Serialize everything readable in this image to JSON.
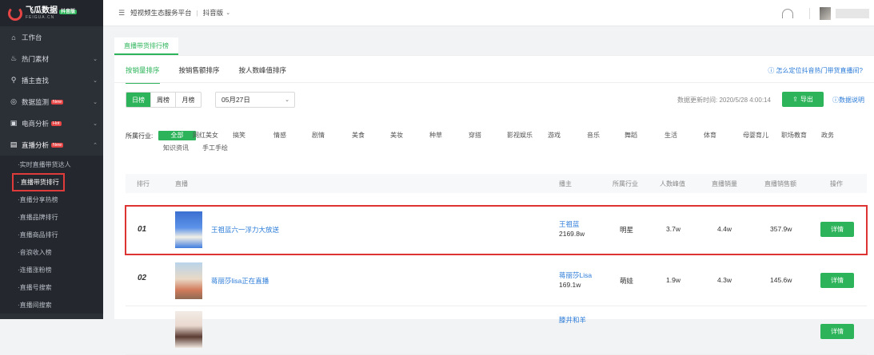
{
  "brand": {
    "name": "飞瓜数据",
    "badge": "抖音版",
    "sub": "FEIGUA.CN"
  },
  "sidebar": {
    "items": [
      {
        "label": "工作台",
        "icon": "home-icon"
      },
      {
        "label": "热门素材",
        "icon": "fire-icon"
      },
      {
        "label": "播主查找",
        "icon": "search-icon"
      },
      {
        "label": "数据监测",
        "icon": "monitor-icon",
        "badge": "New"
      },
      {
        "label": "电商分析",
        "icon": "shop-icon",
        "badge": "Hot"
      },
      {
        "label": "直播分析",
        "icon": "live-icon",
        "badge": "New"
      }
    ],
    "sub_items": [
      "实时直播带货达人",
      "直播带货排行",
      "直播分享热榜",
      "直播品牌排行",
      "直播商品排行",
      "音浪收入榜",
      "连播涨粉榜",
      "直播号搜索",
      "直播间搜索"
    ]
  },
  "topbar": {
    "platform": "短视频生态服务平台",
    "separator": "|",
    "version": "抖音版"
  },
  "card_tab": "直播带货排行榜",
  "sort_tabs": [
    "按销量排序",
    "按销售额排序",
    "按人数峰值排序"
  ],
  "help_link": "怎么定位抖音热门带货直播间?",
  "period_tabs": [
    "日榜",
    "周榜",
    "月榜"
  ],
  "date_value": "05月27日",
  "update_time": "数据更新时间: 2020/5/28 4:00:14",
  "export_label": "导出",
  "data_note_label": "数据说明",
  "industry": {
    "label": "所属行业:",
    "options": [
      "全部",
      "网红美女",
      "搞笑",
      "情感",
      "剧情",
      "美食",
      "美妆",
      "种草",
      "穿搭",
      "影视娱乐",
      "游戏",
      "音乐",
      "舞蹈",
      "生活",
      "体育",
      "母婴育儿",
      "职场教育",
      "政务",
      "知识资讯",
      "手工手绘"
    ]
  },
  "table": {
    "headers": [
      "排行",
      "直播",
      "播主",
      "所属行业",
      "人数峰值",
      "直播销量",
      "直播销售额",
      "操作"
    ],
    "rows": [
      {
        "rank": "01",
        "title": "王祖蓝六一浮力大放送",
        "host": "王祖蓝",
        "fans": "2169.8w",
        "industry": "明星",
        "peak": "3.7w",
        "sales": "4.4w",
        "amount": "357.9w",
        "action": "详情"
      },
      {
        "rank": "02",
        "title": "蒋丽莎lisa正在直播",
        "host": "蒋丽莎Lisa",
        "fans": "169.1w",
        "industry": "萌娃",
        "peak": "1.9w",
        "sales": "4.3w",
        "amount": "145.6w",
        "action": "详情"
      },
      {
        "rank": "03",
        "title": "",
        "host": "滕井和羊",
        "fans": "",
        "industry": "",
        "peak": "",
        "sales": "",
        "amount": "",
        "action": "详情"
      }
    ]
  },
  "colors": {
    "accent": "#2db45a",
    "sidebar_bg": "#2b2f36",
    "link": "#2b7bd8",
    "highlight": "#dd3333"
  }
}
